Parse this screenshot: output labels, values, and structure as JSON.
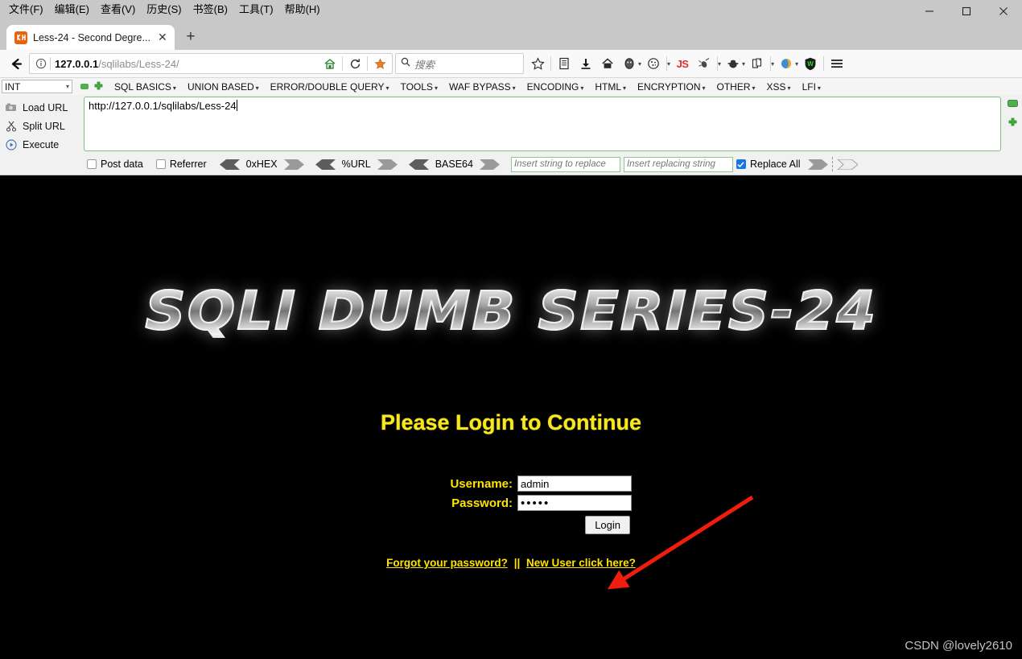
{
  "window": {
    "menus": [
      {
        "label": "文件(F)",
        "accel": "F"
      },
      {
        "label": "编辑(E)",
        "accel": "E"
      },
      {
        "label": "查看(V)",
        "accel": "V"
      },
      {
        "label": "历史(S)",
        "accel": "S"
      },
      {
        "label": "书签(B)",
        "accel": "B"
      },
      {
        "label": "工具(T)",
        "accel": "T"
      },
      {
        "label": "帮助(H)",
        "accel": "H"
      }
    ],
    "controls": {
      "minimize": "minimize-icon",
      "maximize": "maximize-icon",
      "close": "close-icon"
    }
  },
  "tabs": {
    "active_tab_title": "Less-24 - Second Degre...",
    "close_label": "✕",
    "new_tab_label": "+"
  },
  "navbar": {
    "back_icon": "back-arrow-icon",
    "identity_icon": "info-circle-icon",
    "url_host": "127.0.0.1",
    "url_path": "/sqlilabs/Less-24/",
    "url_full": "127.0.0.1/sqlilabs/Less-24/",
    "inline_icons": [
      "home-icon",
      "reload-icon",
      "firefox-pocket-icon"
    ],
    "search_placeholder": "搜索",
    "toolbar_icons": [
      "bookmark-star-icon",
      "library-icon",
      "downloads-icon",
      "home-icon",
      "user-avatar-icon",
      "cookie-icon",
      "javascript-toggle-icon",
      "bug-icon",
      "spoof-identity-icon",
      "copy-page-icon",
      "browser-globe-icon",
      "wappalyzer-shield-icon",
      "hamburger-menu-icon"
    ]
  },
  "hackbar": {
    "select_value": "INT",
    "remove_button": "minus-button",
    "add_button": "plus-button",
    "menus": [
      "SQL BASICS",
      "UNION BASED",
      "ERROR/DOUBLE QUERY",
      "TOOLS",
      "WAF BYPASS",
      "ENCODING",
      "HTML",
      "ENCRYPTION",
      "OTHER",
      "XSS",
      "LFI"
    ],
    "actions": [
      {
        "label": "Load URL",
        "icon": "load-url-icon"
      },
      {
        "label": "Split URL",
        "icon": "split-url-icon"
      },
      {
        "label": "Execute",
        "icon": "execute-icon"
      }
    ],
    "url_value": "http://127.0.0.1/sqlilabs/Less-24",
    "options": {
      "post_data_label": "Post data",
      "post_data_checked": false,
      "referrer_label": "Referrer",
      "referrer_checked": false,
      "encoders": [
        "0xHEX",
        "%URL",
        "BASE64"
      ],
      "replace_search_placeholder": "Insert string to replace",
      "replace_with_placeholder": "Insert replacing string",
      "replace_all_label": "Replace All",
      "replace_all_checked": true
    }
  },
  "page": {
    "banner_text": "SQLI DUMB SERIES-24",
    "heading": "Please Login to Continue",
    "form": {
      "username_label": "Username:",
      "username_value": "admin",
      "password_label": "Password:",
      "password_value": "•••••",
      "submit_label": "Login"
    },
    "links": {
      "forgot": "Forgot your password?",
      "separator": "||",
      "new_user": "New User click here?"
    },
    "watermark": "CSDN @lovely2610"
  },
  "colors": {
    "page_bg": "#000000",
    "heading_yellow": "#f8e71c",
    "link_yellow": "#ffe400",
    "annotation_red": "#f01c0e",
    "accent_green": "#4caf50"
  }
}
